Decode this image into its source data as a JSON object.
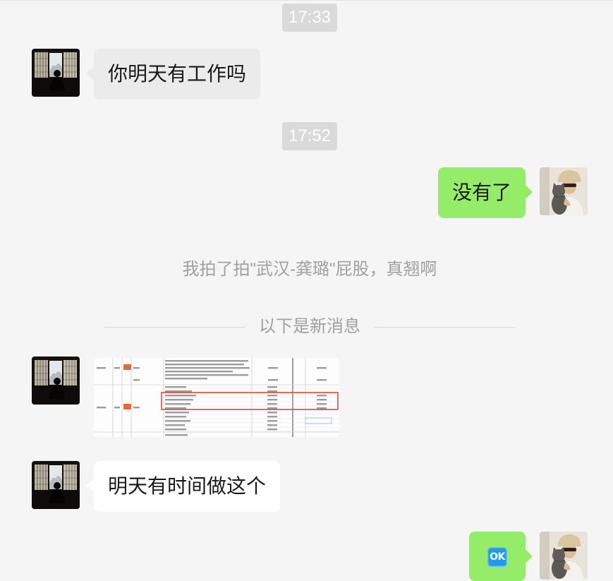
{
  "theme": {
    "background": "#f5f5f5",
    "bubble_sent": "#95ec69",
    "bubble_received": "#ffffff",
    "bubble_received_highlighted": "#ebebeb",
    "timestamp_pill": "#dadada",
    "notice_text": "#a0a0a0",
    "divider_line": "#d8d8d8",
    "ok_emoji": "#1d9bf0"
  },
  "conversation": [
    {
      "timestamp": "17:33"
    },
    {
      "received_text": "你明天有工作吗"
    },
    {
      "timestamp": "17:52"
    },
    {
      "sent_text": "没有了"
    },
    {
      "system_notice": "我拍了拍\"武汉-龚璐\"屁股，真翘啊"
    },
    {
      "divider": "以下是新消息"
    },
    {
      "received_image": true
    },
    {
      "received_text": "明天有时间做这个"
    },
    {
      "sent_emoji": "OK"
    }
  ]
}
